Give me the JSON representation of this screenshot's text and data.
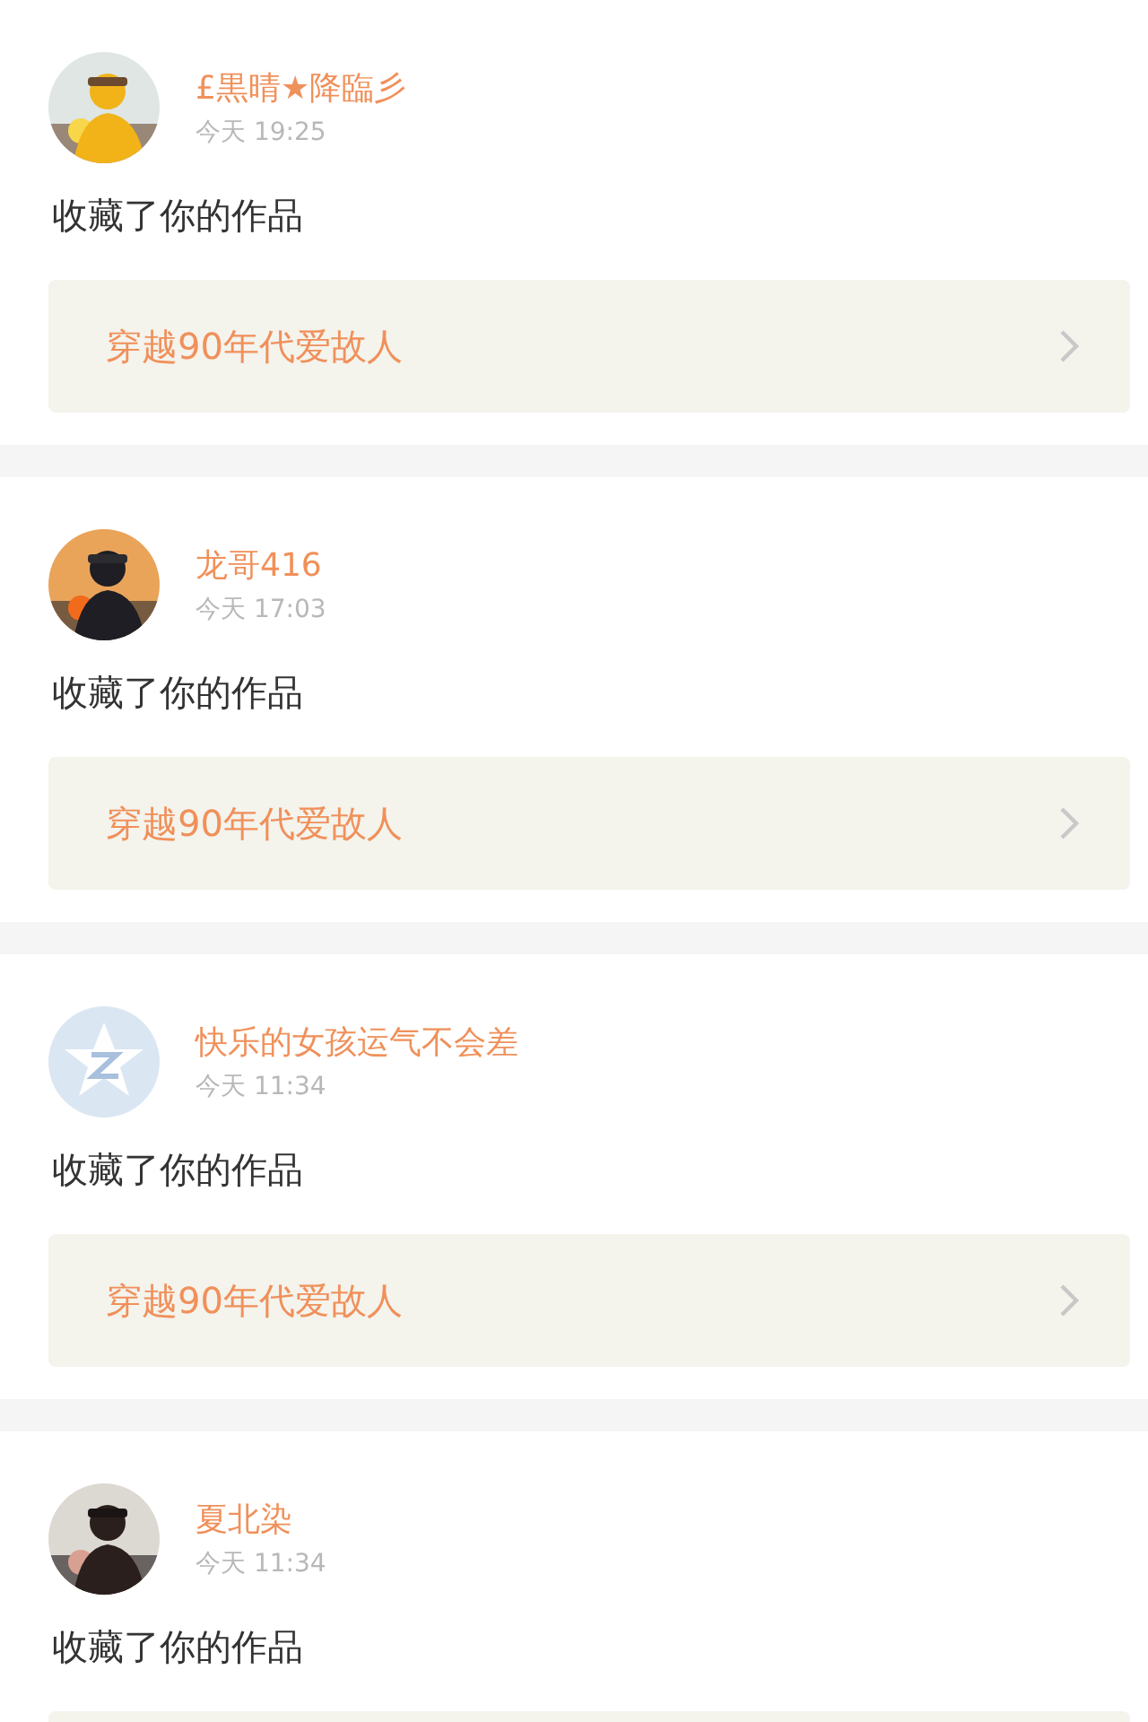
{
  "notifications": [
    {
      "name": "£黒晴★降臨彡",
      "time": "今天 19:25",
      "action": "收藏了你的作品",
      "work": {
        "title": "穿越90年代爱故人"
      }
    },
    {
      "name": "龙哥416",
      "time": "今天 17:03",
      "action": "收藏了你的作品",
      "work": {
        "title": "穿越90年代爱故人"
      }
    },
    {
      "avatar": {
        "kind": "default"
      },
      "name": "快乐的女孩运气不会差",
      "time": "今天 11:34",
      "action": "收藏了你的作品",
      "work": {
        "title": "穿越90年代爱故人"
      }
    },
    {
      "name": "夏北染",
      "time": "今天 11:34",
      "action": "收藏了你的作品"
    }
  ]
}
